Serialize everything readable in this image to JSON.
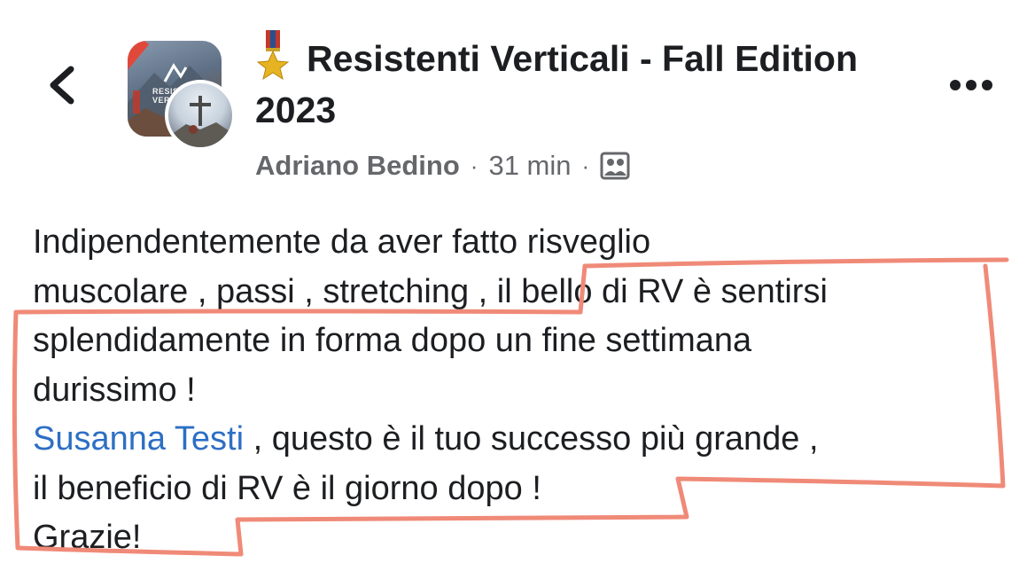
{
  "header": {
    "back_icon": "chevron-left-icon",
    "group_avatar_text": "RESISTENTI VERTICALI",
    "medal_icon": "military-medal-emoji",
    "title": "Resistenti Verticali - Fall Edition 2023",
    "author": "Adriano Bedino",
    "separator": "·",
    "time": "31 min",
    "audience_icon": "group-audience-icon",
    "more_icon": "more-horizontal-icon"
  },
  "post": {
    "line1": "Indipendentemente da aver fatto risveglio",
    "line2": "muscolare , passi , stretching , il bello di RV è sentirsi",
    "line3": "splendidamente in forma dopo un fine settimana",
    "line4": "durissimo !",
    "mention": "Susanna Testi",
    "line5_rest": " , questo è il tuo successo più grande ,",
    "line6": "il beneficio di RV è il giorno dopo !",
    "line7": "Grazie!"
  },
  "colors": {
    "text": "#1c1e21",
    "secondary_text": "#65676b",
    "mention": "#2d6fc4",
    "annotation_stroke": "#f08a78"
  }
}
